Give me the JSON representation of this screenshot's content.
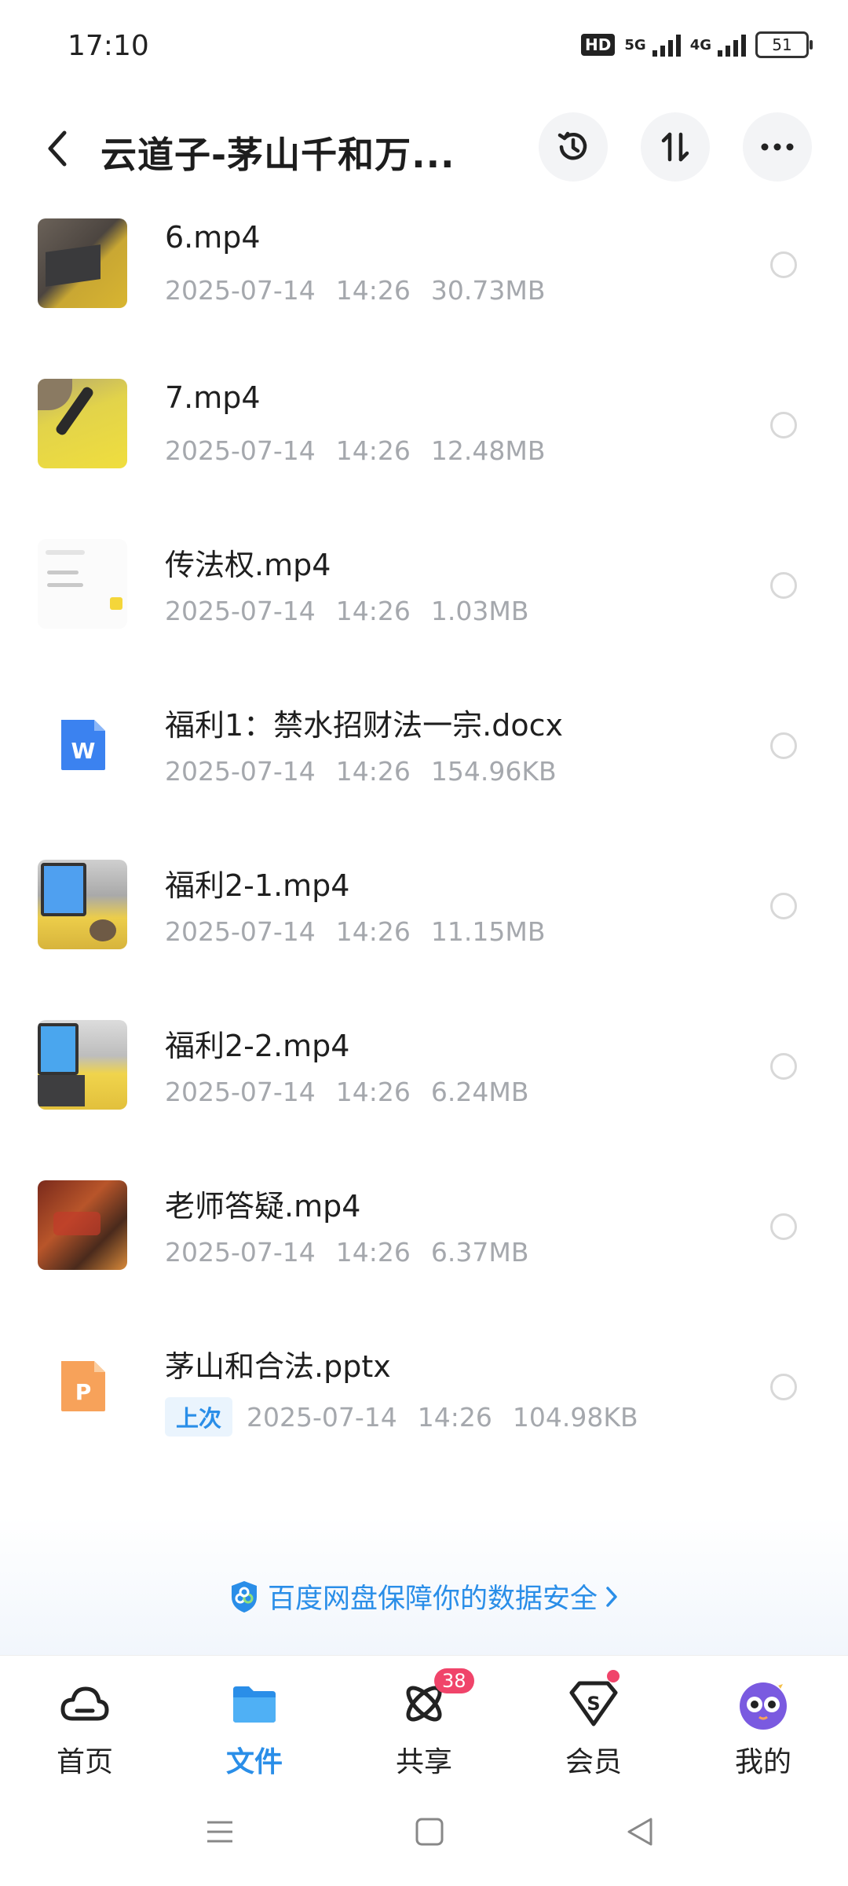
{
  "status": {
    "time": "17:10",
    "hd": "HD",
    "net1": "5G",
    "net2": "4G",
    "battery": "51"
  },
  "header": {
    "title": "云道子-茅山千和万..."
  },
  "files": [
    {
      "name": "6.mp4",
      "date": "2025-07-14",
      "time": "14:26",
      "size": "30.73MB",
      "thumb": "video"
    },
    {
      "name": "7.mp4",
      "date": "2025-07-14",
      "time": "14:26",
      "size": "12.48MB",
      "thumb": "video"
    },
    {
      "name": "传法权.mp4",
      "date": "2025-07-14",
      "time": "14:26",
      "size": "1.03MB",
      "thumb": "video"
    },
    {
      "name": "福利1：禁水招财法一宗.docx",
      "date": "2025-07-14",
      "time": "14:26",
      "size": "154.96KB",
      "thumb": "word-doc-icon"
    },
    {
      "name": "福利2-1.mp4",
      "date": "2025-07-14",
      "time": "14:26",
      "size": "11.15MB",
      "thumb": "video"
    },
    {
      "name": "福利2-2.mp4",
      "date": "2025-07-14",
      "time": "14:26",
      "size": "6.24MB",
      "thumb": "video"
    },
    {
      "name": "老师答疑.mp4",
      "date": "2025-07-14",
      "time": "14:26",
      "size": "6.37MB",
      "thumb": "video"
    },
    {
      "name": "茅山和合法.pptx",
      "tag": "上次",
      "date": "2025-07-14",
      "time": "14:26",
      "size": "104.98KB",
      "thumb": "ppt-doc-icon"
    }
  ],
  "security": {
    "text": "百度网盘保障你的数据安全"
  },
  "tabs": [
    {
      "label": "首页",
      "icon": "cloud-icon"
    },
    {
      "label": "文件",
      "icon": "folder-icon",
      "active": true
    },
    {
      "label": "共享",
      "icon": "atom-icon",
      "badge": "38"
    },
    {
      "label": "会员",
      "icon": "vip-shield-icon"
    },
    {
      "label": "我的",
      "icon": "avatar"
    }
  ],
  "colors": {
    "accent": "#2a8ee8",
    "badge": "#f0446a",
    "word": "#3b82f0",
    "ppt": "#f7a25a"
  }
}
